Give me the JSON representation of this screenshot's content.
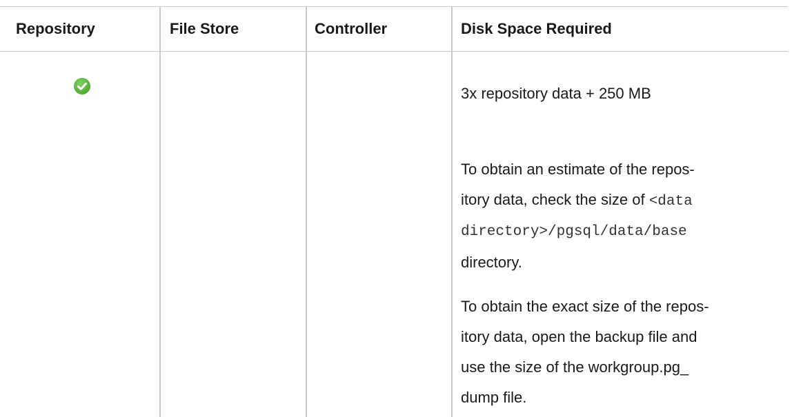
{
  "table": {
    "headers": [
      "Repository",
      "File Store",
      "Controller",
      "Disk Space Required"
    ],
    "row": {
      "repository_icon": "check-circle-icon",
      "file_store": "",
      "controller": "",
      "disk_space": {
        "p1": "3x repository data + 250 MB",
        "p2": {
          "line1": "To obtain an estimate of the repos-",
          "line2_text": "itory data, check the size of ",
          "line2_code": "<data",
          "line3_code": "directory>/pgsql/data/base",
          "line4": "directory."
        },
        "p3": {
          "line1": "To obtain the exact size of the repos-",
          "line2": "itory data, open the backup file and",
          "line3": "use the size of the workgroup.pg_",
          "line4": "dump file."
        }
      }
    }
  },
  "colors": {
    "check_green": "#5cb83f",
    "border": "#c9c9c9",
    "text": "#1a1a1a"
  }
}
